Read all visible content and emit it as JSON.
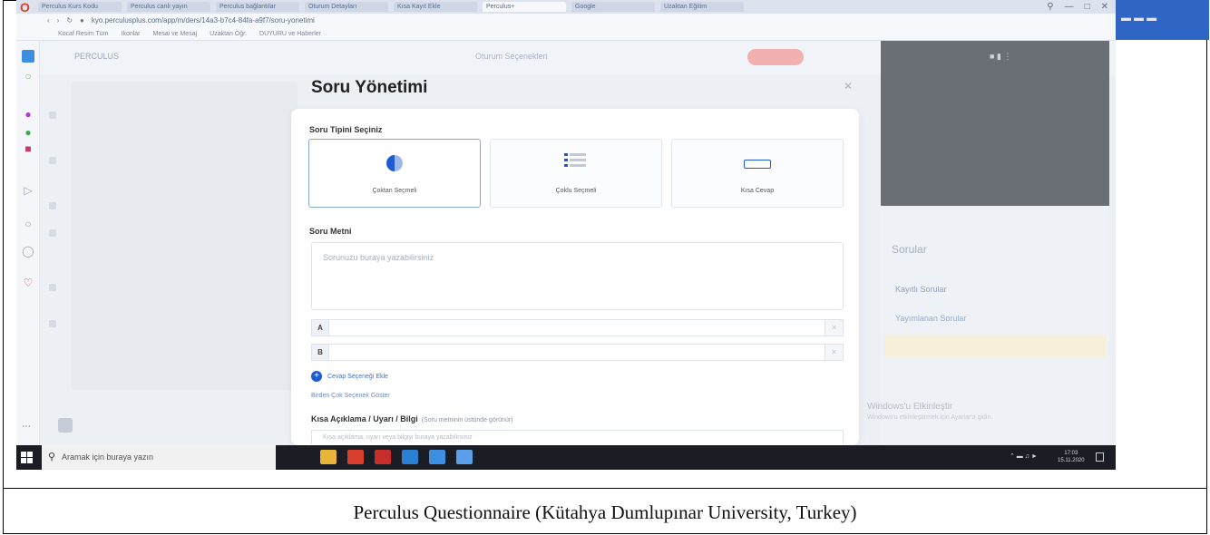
{
  "browser": {
    "tabs": [
      "Perculus Kurs Kodu",
      "Perculus canlı yayın",
      "Perculus bağlantılar",
      "Oturum Detayları",
      "Kısa Kayıt Ekle",
      "Perculus+",
      "Google",
      "Uzaktan Eğitim"
    ],
    "active_tab_index": 5,
    "url": "kyo.perculusplus.com/app/m/ders/14a3-b7c4-84fa-a9f7/soru-yonetimi",
    "bookmarks": [
      "Kocaf Resim Tüm",
      "Ikonlar",
      "Mesai ve Mesaj",
      "Uzaktan Öğr.",
      "DUYURU ve Haberler"
    ]
  },
  "app": {
    "session_title": "PERCULUS",
    "session_menu": "Oturum Seçenekleri",
    "side_panel_title": "Sorular",
    "side_panel_item1": "Kayıtlı Sorular",
    "side_panel_item2": "Yayımlanan Sorular",
    "activation_title": "Windows'u Etkinleştir",
    "activation_sub": "Windows'u etkinleştirmek için Ayarlar'a gidin."
  },
  "modal": {
    "title": "Soru Yönetimi",
    "type_section_label": "Soru Tipini Seçiniz",
    "types": [
      {
        "label": "Çoktan Seçmeli",
        "icon": "half-circle-icon",
        "selected": true
      },
      {
        "label": "Çoklu Seçmeli",
        "icon": "checklist-icon",
        "selected": false
      },
      {
        "label": "Kısa Cevap",
        "icon": "text-box-icon",
        "selected": false
      }
    ],
    "question_text_label": "Soru Metni",
    "question_placeholder": "Sorunuzu buraya yazabilirsiniz",
    "options": [
      {
        "key": "A",
        "value": ""
      },
      {
        "key": "B",
        "value": ""
      }
    ],
    "add_option_label": "Cevap Seçeneği Ekle",
    "multi_answer_link": "Birden Çok Seçenek Göster",
    "note_label": "Kısa Açıklama / Uyarı / Bilgi",
    "note_hint": "(Soru metninin üstünde görünür)",
    "note_placeholder": "Kısa açıklama, uyarı veya bilgiyi buraya yazabilirsiniz"
  },
  "taskbar": {
    "search_placeholder": "Aramak için buraya yazın",
    "time": "17:03",
    "date": "15.11.2020"
  },
  "caption": "Perculus Questionnaire (Kütahya Dumlupınar University, Turkey)",
  "colors": {
    "accent": "#1e5ad2",
    "taskbar": "#1c1d24",
    "selected_card_border": "#8aa8cc"
  }
}
